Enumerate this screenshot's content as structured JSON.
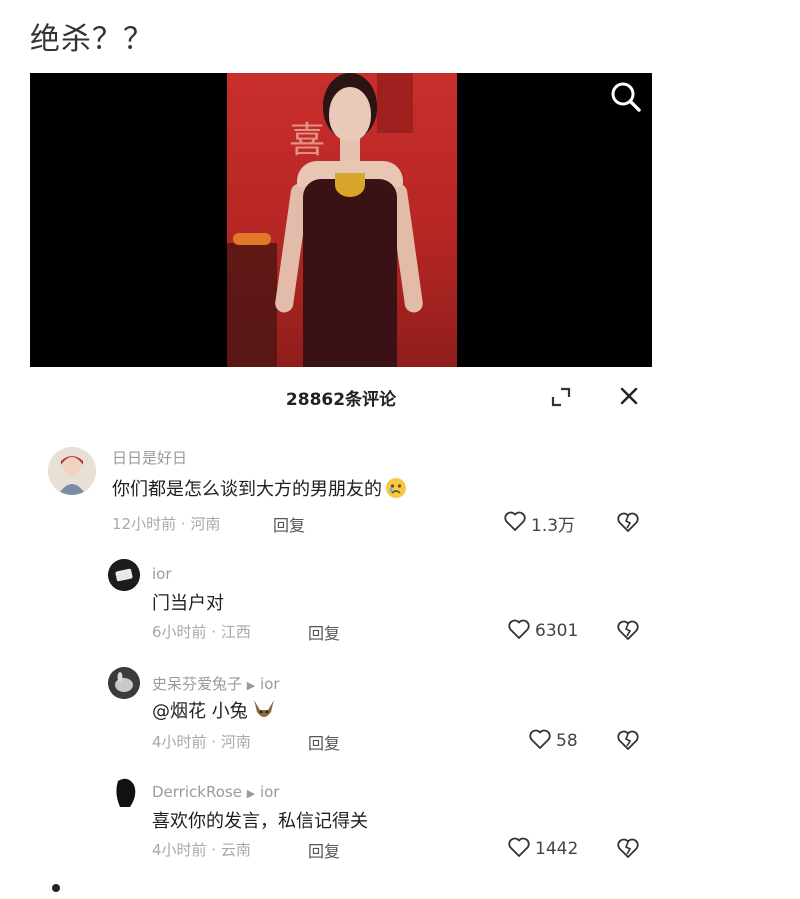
{
  "post": {
    "title": "绝杀？？"
  },
  "video": {
    "deco_char": "喜",
    "search_icon": "search-icon"
  },
  "comments_panel": {
    "count_label": "28862条评论",
    "expand_icon": "expand-icon",
    "close_icon": "close-icon"
  },
  "comments": [
    {
      "user": "日日是好日",
      "text": "你们都是怎么谈到大方的男朋友的",
      "emoji": "crying-face-emoji",
      "meta": "12小时前 · 河南",
      "reply_label": "回复",
      "likes": "1.3万"
    },
    {
      "user": "ior",
      "text": "门当户对",
      "meta": "6小时前 · 江西",
      "reply_label": "回复",
      "likes": "6301"
    },
    {
      "user": "史呆芬爱兔子",
      "reply_to": "ior",
      "text": "@烟花  小兔",
      "emoji": "rabbit-emoji",
      "meta": "4小时前 · 河南",
      "reply_label": "回复",
      "likes": "58"
    },
    {
      "user": "DerrickRose",
      "reply_to": "ior",
      "text": "喜欢你的发言，私信记得关",
      "meta": "4小时前 · 云南",
      "reply_label": "回复",
      "likes": "1442"
    }
  ],
  "colors": {
    "video_bg": "#000000",
    "stage_red": "#c92e2c",
    "muted_text": "#9a9a9a"
  }
}
